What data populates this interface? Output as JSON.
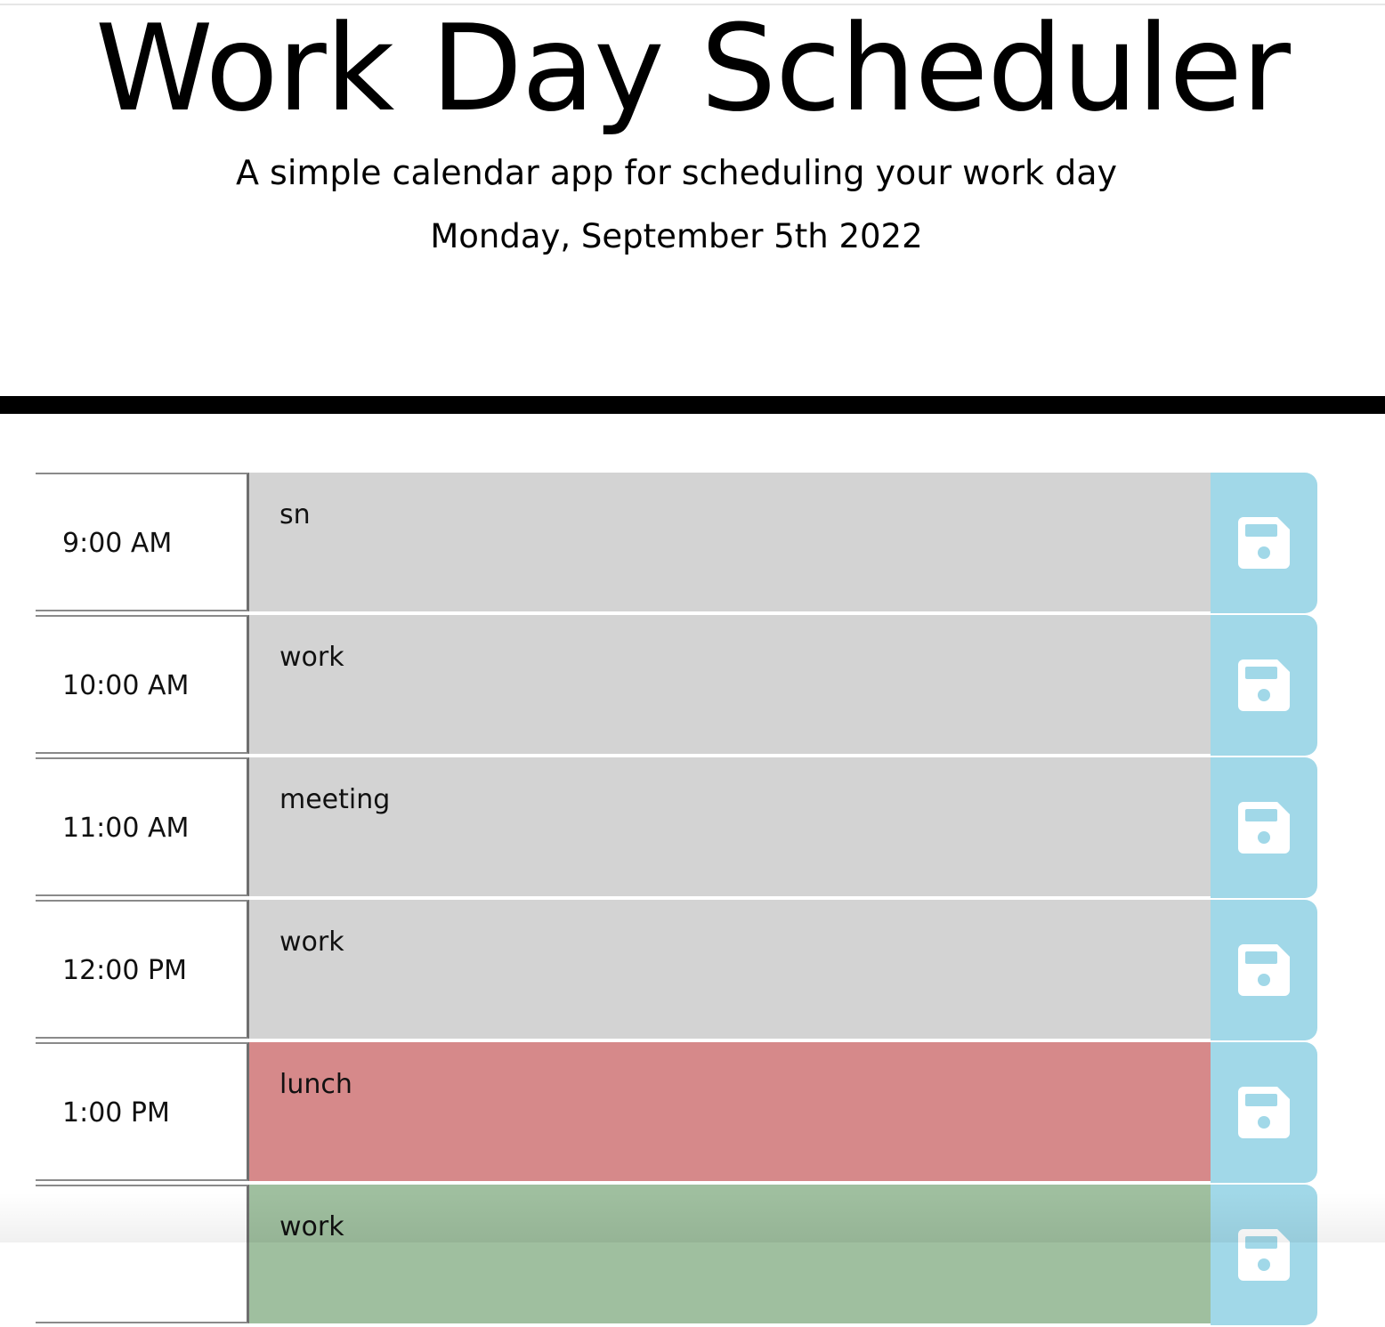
{
  "header": {
    "title": "Work Day Scheduler",
    "subtitle": "A simple calendar app for scheduling your work day",
    "current_day": "Monday, September 5th 2022"
  },
  "colors": {
    "past": "#d3d3d3",
    "present": "#d6898a",
    "future": "#9fbf9f",
    "save_button": "#a1d8e8"
  },
  "time_blocks": [
    {
      "hour": "9:00 AM",
      "text": "sn",
      "status": "past",
      "save_icon": "floppy-disk-icon"
    },
    {
      "hour": "10:00 AM",
      "text": "work",
      "status": "past",
      "save_icon": "floppy-disk-icon"
    },
    {
      "hour": "11:00 AM",
      "text": "meeting",
      "status": "past",
      "save_icon": "floppy-disk-icon"
    },
    {
      "hour": "12:00 PM",
      "text": "work",
      "status": "past",
      "save_icon": "floppy-disk-icon"
    },
    {
      "hour": "1:00 PM",
      "text": "lunch",
      "status": "present",
      "save_icon": "floppy-disk-icon"
    },
    {
      "hour": "",
      "text": "work",
      "status": "future",
      "save_icon": "floppy-disk-icon"
    }
  ]
}
